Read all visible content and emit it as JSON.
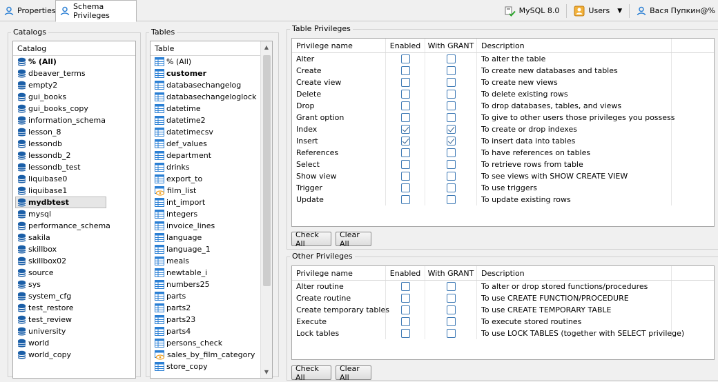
{
  "tabs": [
    {
      "label": "Properties",
      "icon": "user-icon"
    },
    {
      "label": "Schema Privileges",
      "icon": "user-icon"
    }
  ],
  "toolbar": {
    "connection": "MySQL 8.0",
    "users_label": "Users",
    "current_user": "Вася Пупкин@%"
  },
  "catalogs": {
    "title": "Catalogs",
    "column": "Catalog",
    "items": [
      "% (All)",
      "dbeaver_terms",
      "empty2",
      "gui_books",
      "gui_books_copy",
      "information_schema",
      "lesson_8",
      "lessondb",
      "lessondb_2",
      "lessondb_test",
      "liquibase0",
      "liquibase1",
      "mydbtest",
      "mysql",
      "performance_schema",
      "sakila",
      "skillbox",
      "skillbox02",
      "source",
      "sys",
      "system_cfg",
      "test_restore",
      "test_review",
      "university",
      "world",
      "world_copy"
    ],
    "bold_items": [
      "% (All)",
      "mydbtest"
    ],
    "selected": "mydbtest"
  },
  "tables": {
    "title": "Tables",
    "column": "Table",
    "items": [
      "% (All)",
      "customer",
      "databasechangelog",
      "databasechangeloglock",
      "datetime",
      "datetime2",
      "datetimecsv",
      "def_values",
      "department",
      "drinks",
      "export_to",
      "film_list",
      "int_import",
      "integers",
      "invoice_lines",
      "language",
      "language_1",
      "meals",
      "newtable_i",
      "numbers25",
      "parts",
      "parts2",
      "parts23",
      "parts4",
      "persons_check",
      "sales_by_film_category",
      "store_copy"
    ],
    "bold_items": [
      "customer"
    ],
    "view_items": [
      "film_list",
      "sales_by_film_category"
    ]
  },
  "table_privileges": {
    "title": "Table Privileges",
    "headers": {
      "name": "Privilege name",
      "enabled": "Enabled",
      "grant": "With GRANT",
      "description": "Description"
    },
    "rows": [
      {
        "name": "Alter",
        "enabled": false,
        "grant": false,
        "description": "To alter the table"
      },
      {
        "name": "Create",
        "enabled": false,
        "grant": false,
        "description": "To create new databases and tables"
      },
      {
        "name": "Create view",
        "enabled": false,
        "grant": false,
        "description": "To create new views"
      },
      {
        "name": "Delete",
        "enabled": false,
        "grant": false,
        "description": "To delete existing rows"
      },
      {
        "name": "Drop",
        "enabled": false,
        "grant": false,
        "description": "To drop databases, tables, and views"
      },
      {
        "name": "Grant option",
        "enabled": false,
        "grant": false,
        "description": "To give to other users those privileges you possess"
      },
      {
        "name": "Index",
        "enabled": true,
        "grant": true,
        "description": "To create or drop indexes"
      },
      {
        "name": "Insert",
        "enabled": true,
        "grant": true,
        "description": "To insert data into tables"
      },
      {
        "name": "References",
        "enabled": false,
        "grant": false,
        "description": "To have references on tables"
      },
      {
        "name": "Select",
        "enabled": false,
        "grant": false,
        "description": "To retrieve rows from table"
      },
      {
        "name": "Show view",
        "enabled": false,
        "grant": false,
        "description": "To see views with SHOW CREATE VIEW"
      },
      {
        "name": "Trigger",
        "enabled": false,
        "grant": false,
        "description": "To use triggers"
      },
      {
        "name": "Update",
        "enabled": false,
        "grant": false,
        "description": "To update existing rows"
      }
    ],
    "check_all": "Check All",
    "clear_all": "Clear All"
  },
  "other_privileges": {
    "title": "Other Privileges",
    "headers": {
      "name": "Privilege name",
      "enabled": "Enabled",
      "grant": "With GRANT",
      "description": "Description"
    },
    "rows": [
      {
        "name": "Alter routine",
        "enabled": false,
        "grant": false,
        "description": "To alter or drop stored functions/procedures"
      },
      {
        "name": "Create routine",
        "enabled": false,
        "grant": false,
        "description": "To use CREATE FUNCTION/PROCEDURE"
      },
      {
        "name": "Create temporary tables",
        "enabled": false,
        "grant": false,
        "description": "To use CREATE TEMPORARY TABLE"
      },
      {
        "name": "Execute",
        "enabled": false,
        "grant": false,
        "description": "To execute stored routines"
      },
      {
        "name": "Lock tables",
        "enabled": false,
        "grant": false,
        "description": "To use LOCK TABLES (together with SELECT privilege)"
      }
    ],
    "check_all": "Check All",
    "clear_all": "Clear All"
  },
  "colors": {
    "accent": "#3c78b4",
    "table_icon": "#2a7fd4",
    "view_icon": "#f0a020"
  }
}
